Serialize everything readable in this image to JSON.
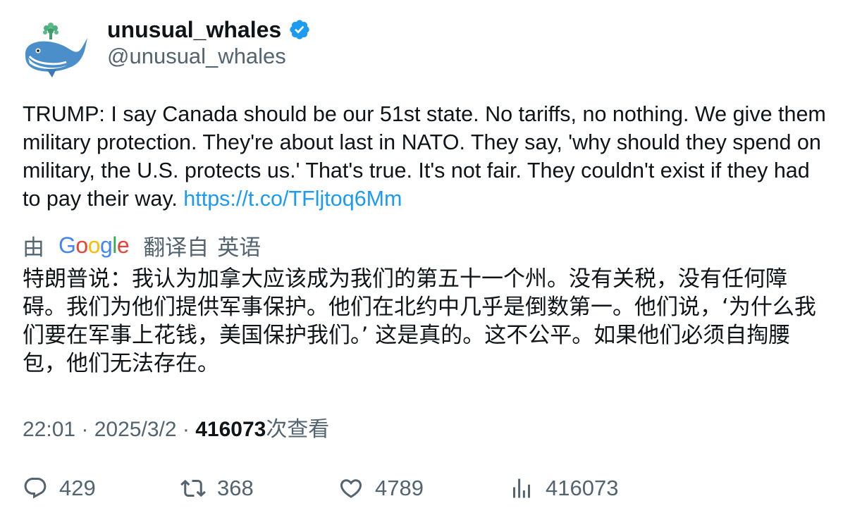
{
  "author": {
    "display_name": "unusual_whales",
    "handle": "@unusual_whales"
  },
  "tweet": {
    "text": "TRUMP: I say Canada should be our 51st state. No tariffs, no nothing. We give them military protection. They're about last in NATO. They say, 'why should they spend on military, the U.S. protects us.' That's true. It's not fair. They couldn't exist if they had to pay their way. ",
    "link": "https://t.co/TFljtoq6Mm"
  },
  "translation": {
    "by_label": "由",
    "logo_text": "Google",
    "from_label": "翻译自",
    "language": "英语",
    "text": "特朗普说：我认为加拿大应该成为我们的第五十一个州。没有关税，没有任何障碍。我们为他们提供军事保护。他们在北约中几乎是倒数第一。他们说，‘为什么我们要在军事上花钱，美国保护我们。’ 这是真的。这不公平。如果他们必须自掏腰包，他们无法存在。"
  },
  "meta": {
    "time": "22:01",
    "separator1": " · ",
    "date": "2025/3/2",
    "separator2": " · ",
    "views": "416073",
    "views_label": "次查看"
  },
  "actions": {
    "replies": "429",
    "retweets": "368",
    "likes": "4789",
    "views": "416073"
  },
  "colors": {
    "link": "#1d9bf0",
    "secondary_text": "#536471",
    "verified": "#1d9bf0"
  },
  "icons": [
    "whale-avatar",
    "verified-badge-icon",
    "reply-icon",
    "retweet-icon",
    "like-icon",
    "views-icon"
  ]
}
